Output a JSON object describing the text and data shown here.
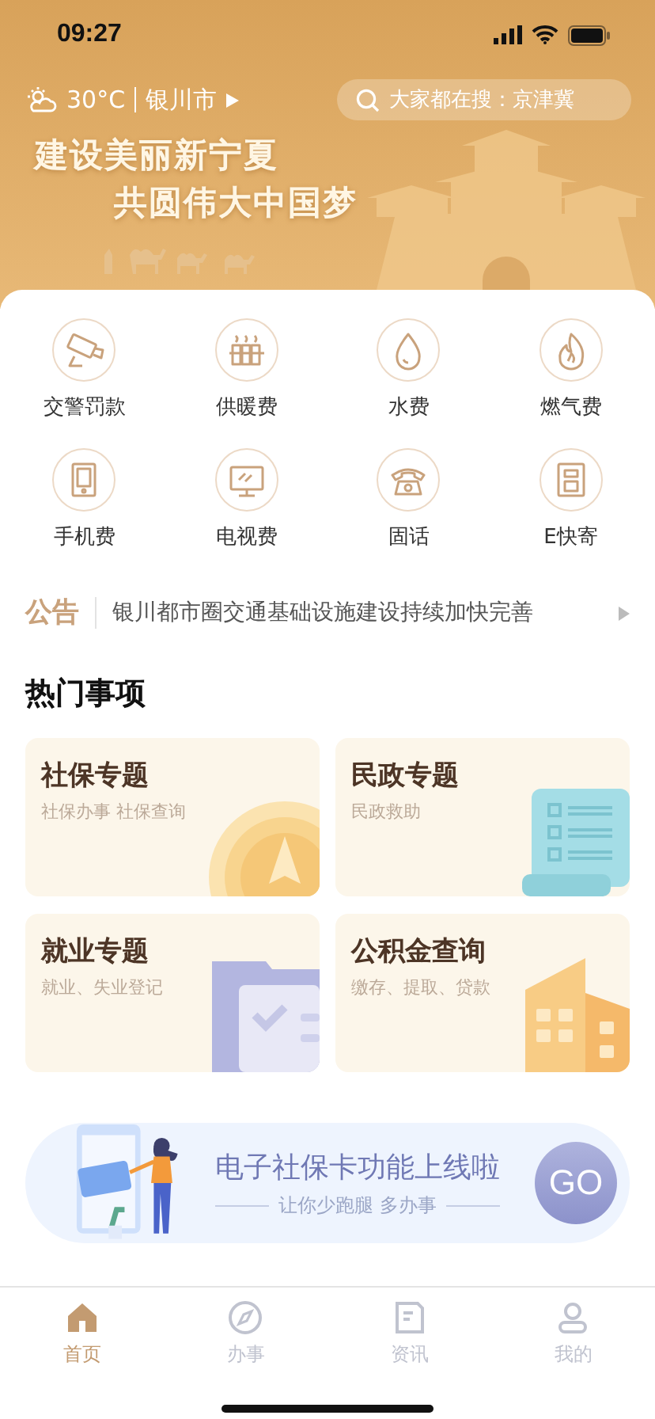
{
  "status_bar": {
    "time": "09:27"
  },
  "header": {
    "temperature": "30°C",
    "city": "银川市",
    "search": {
      "placeholder": "大家都在搜：京津冀"
    },
    "slogans": [
      "建设美丽新宁夏",
      "共圆伟大中国梦"
    ]
  },
  "services": [
    {
      "label": "交警罚款",
      "kind": "camera"
    },
    {
      "label": "供暖费",
      "kind": "heater"
    },
    {
      "label": "水费",
      "kind": "drop"
    },
    {
      "label": "燃气费",
      "kind": "flame"
    },
    {
      "label": "手机费",
      "kind": "phone"
    },
    {
      "label": "电视费",
      "kind": "tv"
    },
    {
      "label": "固话",
      "kind": "telephone"
    },
    {
      "label": "E快寄",
      "kind": "parcel"
    }
  ],
  "notice": {
    "tag": "公告",
    "text": "银川都市圈交通基础设施建设持续加快完善"
  },
  "hot": {
    "title": "热门事项",
    "cards": [
      {
        "title": "社保专题",
        "subtitle": "社保办事 社保查询",
        "kind": "coin"
      },
      {
        "title": "民政专题",
        "subtitle": "民政救助",
        "kind": "scroll"
      },
      {
        "title": "就业专题",
        "subtitle": "就业、失业登记",
        "kind": "folder"
      },
      {
        "title": "公积金查询",
        "subtitle": "缴存、提取、贷款",
        "kind": "building"
      }
    ]
  },
  "banner": {
    "title": "电子社保卡功能上线啦",
    "subtitle": "让你少跑腿 多办事",
    "button": "GO"
  },
  "tabs": [
    {
      "label": "首页",
      "kind": "home",
      "selected": true
    },
    {
      "label": "办事",
      "kind": "compass",
      "selected": false
    },
    {
      "label": "资讯",
      "kind": "news",
      "selected": false
    },
    {
      "label": "我的",
      "kind": "person",
      "selected": false
    }
  ]
}
